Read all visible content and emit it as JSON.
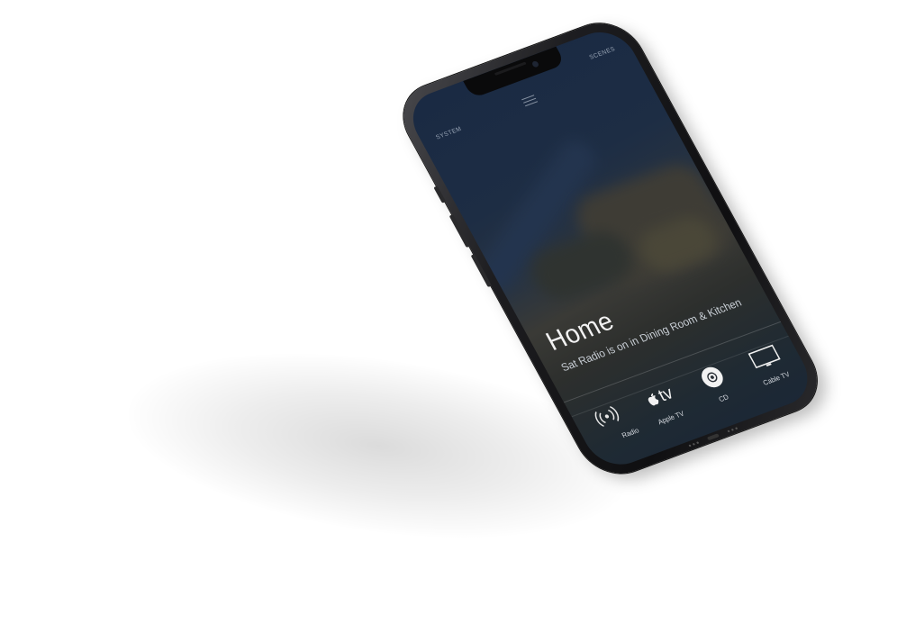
{
  "app": {
    "nav": {
      "left_label": "SYSTEM",
      "right_label": "SCENES",
      "menu_icon": "hamburger-menu-icon"
    },
    "room": {
      "title": "Home",
      "status": "Sat Radio is on in Dining Room & Kitchen"
    },
    "sources": [
      {
        "label": "Radio",
        "icon": "broadcast-radio-icon"
      },
      {
        "label": "Apple TV",
        "icon": "apple-tv-logo"
      },
      {
        "label": "CD",
        "icon": "disc-icon"
      },
      {
        "label": "Cable TV",
        "icon": "tv-screen-icon"
      }
    ],
    "apple_tv_logo_text": "tv"
  },
  "colors": {
    "screen_top": "#1a2a43",
    "screen_mid": "#3a3a36",
    "text_primary": "#f2f2f2",
    "text_secondary": "#c9cfd6",
    "phone_frame": "#1d1d20"
  }
}
